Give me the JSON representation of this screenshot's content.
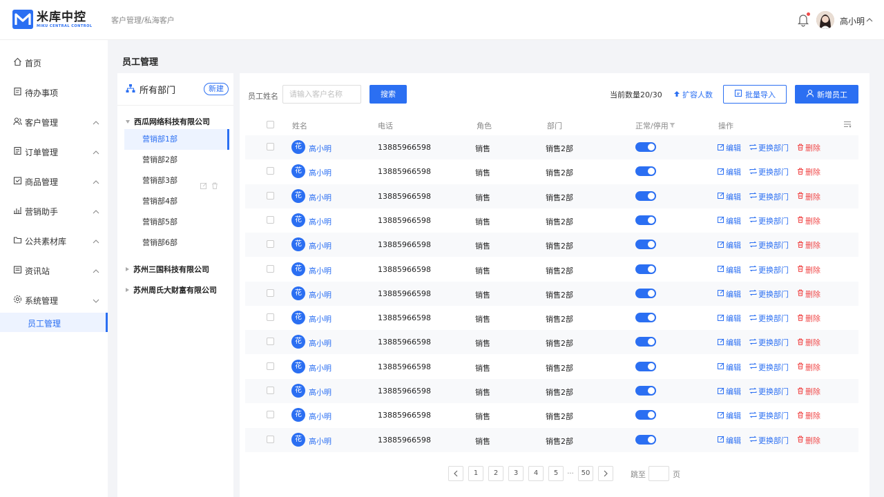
{
  "app": {
    "logo_cn": "米库中控",
    "logo_en": "MIKU CENTRAL CONTROL",
    "breadcrumb": "客户管理/私海客户",
    "user_name": "高小明",
    "accent": "#2b6ff2",
    "danger": "#f04848"
  },
  "sidebar": {
    "items": [
      {
        "label": "首页",
        "icon": "home-icon"
      },
      {
        "label": "待办事项",
        "icon": "todo-icon"
      },
      {
        "label": "客户管理",
        "icon": "customers-icon"
      },
      {
        "label": "订单管理",
        "icon": "orders-icon"
      },
      {
        "label": "商品管理",
        "icon": "products-icon"
      },
      {
        "label": "营销助手",
        "icon": "marketing-icon"
      },
      {
        "label": "公共素材库",
        "icon": "folder-icon"
      },
      {
        "label": "资讯站",
        "icon": "news-icon"
      },
      {
        "label": "系统管理",
        "icon": "settings-icon"
      }
    ],
    "active_sub": "员工管理"
  },
  "page": {
    "title": "员工管理"
  },
  "departments": {
    "header": "所有部门",
    "new_label": "新建",
    "companies": [
      {
        "name": "西瓜网络科技有限公司",
        "expanded": true
      },
      {
        "name": "苏州三国科技有限公司",
        "expanded": false
      },
      {
        "name": "苏州周氏大财富有限公司",
        "expanded": false
      }
    ],
    "depts": [
      "营销部1部",
      "营销部2部",
      "营销部3部",
      "营销部4部",
      "营销部5部",
      "营销部6部"
    ],
    "active_index": 0
  },
  "filter": {
    "label": "员工姓名",
    "placeholder": "请输入客户名称",
    "search_label": "搜索",
    "quota": "当前数量20/30",
    "expand_label": "扩容人数",
    "import_label": "批量导入",
    "add_label": "新增员工"
  },
  "table": {
    "headers": {
      "name": "姓名",
      "phone": "电话",
      "role": "角色",
      "dept": "部门",
      "status": "正常/停用",
      "ops": "操作"
    },
    "actions": {
      "edit": "编辑",
      "change": "更换部门",
      "delete": "删除"
    },
    "rows": [
      {
        "badge": "花",
        "name": "高小明",
        "phone": "13885966598",
        "role": "销售",
        "dept": "销售2部",
        "active": true
      },
      {
        "badge": "花",
        "name": "高小明",
        "phone": "13885966598",
        "role": "销售",
        "dept": "销售2部",
        "active": true
      },
      {
        "badge": "花",
        "name": "高小明",
        "phone": "13885966598",
        "role": "销售",
        "dept": "销售2部",
        "active": true
      },
      {
        "badge": "花",
        "name": "高小明",
        "phone": "13885966598",
        "role": "销售",
        "dept": "销售2部",
        "active": true
      },
      {
        "badge": "花",
        "name": "高小明",
        "phone": "13885966598",
        "role": "销售",
        "dept": "销售2部",
        "active": true
      },
      {
        "badge": "花",
        "name": "高小明",
        "phone": "13885966598",
        "role": "销售",
        "dept": "销售2部",
        "active": true
      },
      {
        "badge": "花",
        "name": "高小明",
        "phone": "13885966598",
        "role": "销售",
        "dept": "销售2部",
        "active": true
      },
      {
        "badge": "花",
        "name": "高小明",
        "phone": "13885966598",
        "role": "销售",
        "dept": "销售2部",
        "active": true
      },
      {
        "badge": "花",
        "name": "高小明",
        "phone": "13885966598",
        "role": "销售",
        "dept": "销售2部",
        "active": true
      },
      {
        "badge": "花",
        "name": "高小明",
        "phone": "13885966598",
        "role": "销售",
        "dept": "销售2部",
        "active": true
      },
      {
        "badge": "花",
        "name": "高小明",
        "phone": "13885966598",
        "role": "销售",
        "dept": "销售2部",
        "active": true
      },
      {
        "badge": "花",
        "name": "高小明",
        "phone": "13885966598",
        "role": "销售",
        "dept": "销售2部",
        "active": true
      },
      {
        "badge": "花",
        "name": "高小明",
        "phone": "13885966598",
        "role": "销售",
        "dept": "销售2部",
        "active": true
      }
    ]
  },
  "pagination": {
    "pages": [
      "1",
      "2",
      "3",
      "4",
      "5"
    ],
    "ellipsis": "···",
    "last": "50",
    "jump_label": "跳至",
    "page_suffix": "页"
  }
}
